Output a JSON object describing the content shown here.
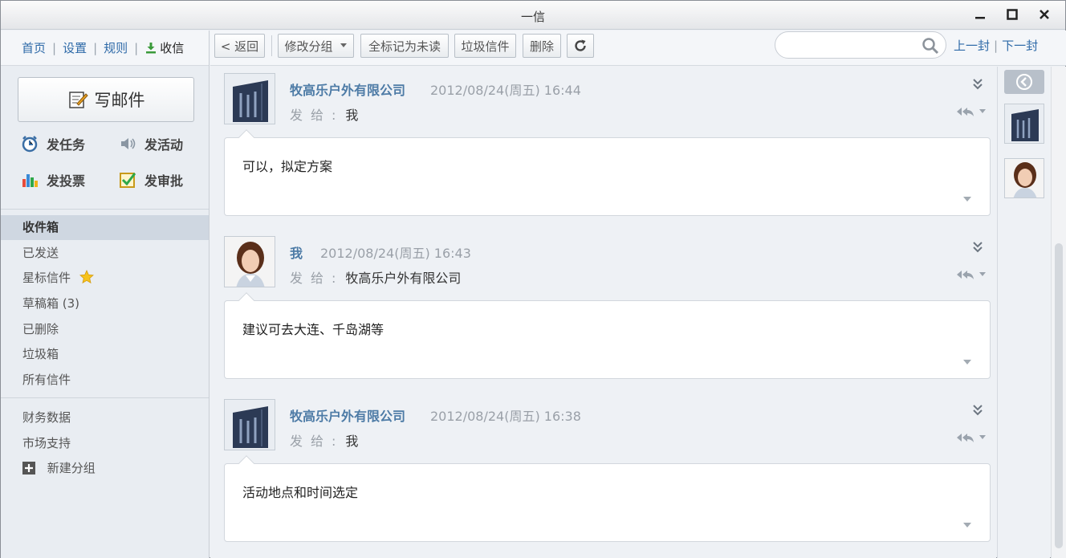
{
  "window": {
    "title": "一信"
  },
  "topnav": {
    "home": "首页",
    "settings": "设置",
    "rules": "规则",
    "receive": "收信"
  },
  "compose": {
    "label": "写邮件"
  },
  "quick_actions": [
    {
      "label": "发任务",
      "icon": "alarm-clock-icon"
    },
    {
      "label": "发活动",
      "icon": "speaker-icon"
    },
    {
      "label": "发投票",
      "icon": "bar-chart-icon"
    },
    {
      "label": "发审批",
      "icon": "checkbox-icon"
    }
  ],
  "folders": [
    {
      "label": "收件箱",
      "active": true
    },
    {
      "label": "已发送"
    },
    {
      "label": "星标信件"
    },
    {
      "label": "草稿箱 (3)"
    },
    {
      "label": "已删除"
    },
    {
      "label": "垃圾箱"
    },
    {
      "label": "所有信件"
    }
  ],
  "groups": [
    {
      "label": "财务数据"
    },
    {
      "label": "市场支持"
    }
  ],
  "new_group": "新建分组",
  "toolbar": {
    "back": "< 返回",
    "change_group": "修改分组",
    "mark_unread": "全标记为未读",
    "spam": "垃圾信件",
    "delete": "删除",
    "search_placeholder": "",
    "prev": "上一封",
    "next": "下一封"
  },
  "messages": [
    {
      "sender": "牧高乐户外有限公司",
      "date": "2012/08/24(周五) 16:44",
      "to_label": "发给:",
      "to": "我",
      "body": "可以，拟定方案",
      "avatar": "company-logo"
    },
    {
      "sender": "我",
      "date": "2012/08/24(周五) 16:43",
      "to_label": "发给:",
      "to": "牧高乐户外有限公司",
      "body": "建议可去大连、千岛湖等",
      "avatar": "person-photo"
    },
    {
      "sender": "牧高乐户外有限公司",
      "date": "2012/08/24(周五) 16:38",
      "to_label": "发给:",
      "to": "我",
      "body": "活动地点和时间选定",
      "avatar": "company-logo"
    }
  ],
  "colors": {
    "link": "#2e6aa8",
    "sender": "#4d7ba6",
    "active_folder": "#cfd7e1"
  }
}
